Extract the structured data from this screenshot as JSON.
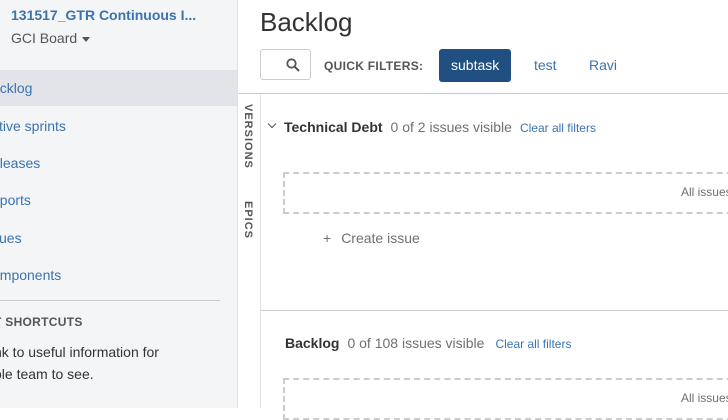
{
  "sidebar": {
    "project_title": "131517_GTR Continuous I...",
    "board_name": "GCI Board",
    "nav_items": [
      {
        "label": "acklog"
      },
      {
        "label": "ctive sprints"
      },
      {
        "label": "eleases"
      },
      {
        "label": "eports"
      },
      {
        "label": "sues"
      },
      {
        "label": "omponents"
      }
    ],
    "shortcuts_heading": "T SHORTCUTS",
    "shortcuts_line1": "nk to useful information for",
    "shortcuts_line2": "ole team to see."
  },
  "header": {
    "title": "Backlog",
    "quick_filters_label": "QUICK FILTERS:",
    "quick_filters": [
      {
        "label": "subtask",
        "active": true
      },
      {
        "label": "test",
        "active": false
      },
      {
        "label": "Ravi",
        "active": false
      }
    ]
  },
  "side_tabs": {
    "versions": "VERSIONS",
    "epics": "EPICS"
  },
  "technical_debt": {
    "title": "Technical Debt",
    "count": "0 of 2 issues visible",
    "clear": "Clear all filters",
    "drop_text": "All issues in t",
    "create": "Create issue"
  },
  "backlog": {
    "title": "Backlog",
    "count": "0 of 108 issues visible",
    "clear": "Clear all filters",
    "drop_text": "All issues in t"
  },
  "icons": {
    "search": "search-icon",
    "caret": "caret-down-icon",
    "chevron": "chevron-down-icon"
  },
  "colors": {
    "link": "#3b73af",
    "active_filter": "#205081"
  }
}
